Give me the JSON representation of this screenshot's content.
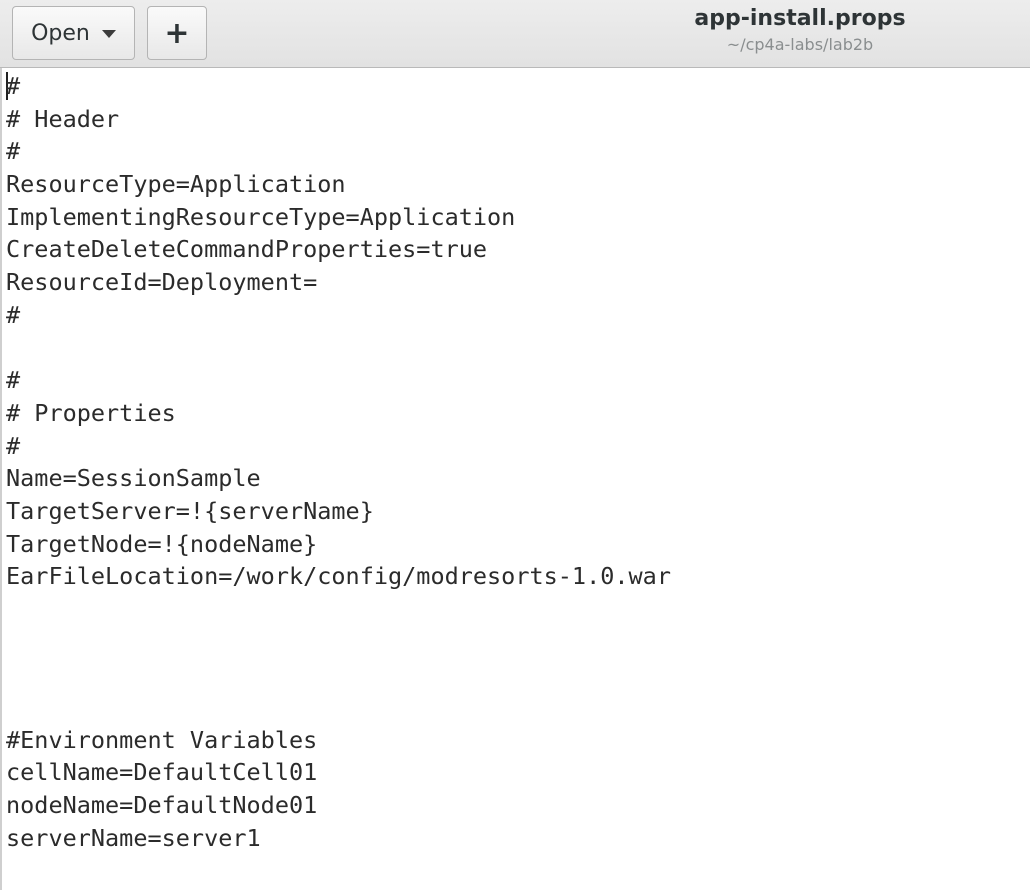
{
  "header": {
    "open_label": "Open",
    "new_tab_label": "+",
    "title": "app-install.props",
    "subtitle": "~/cp4a-labs/lab2b"
  },
  "editor": {
    "lines": [
      "#",
      "# Header",
      "#",
      "ResourceType=Application",
      "ImplementingResourceType=Application",
      "CreateDeleteCommandProperties=true",
      "ResourceId=Deployment=",
      "#",
      "",
      "#",
      "# Properties",
      "#",
      "Name=SessionSample",
      "TargetServer=!{serverName}",
      "TargetNode=!{nodeName}",
      "EarFileLocation=/work/config/modresorts-1.0.war",
      "",
      "",
      "",
      "",
      "#Environment Variables",
      "cellName=DefaultCell01",
      "nodeName=DefaultNode01",
      "serverName=server1"
    ]
  }
}
